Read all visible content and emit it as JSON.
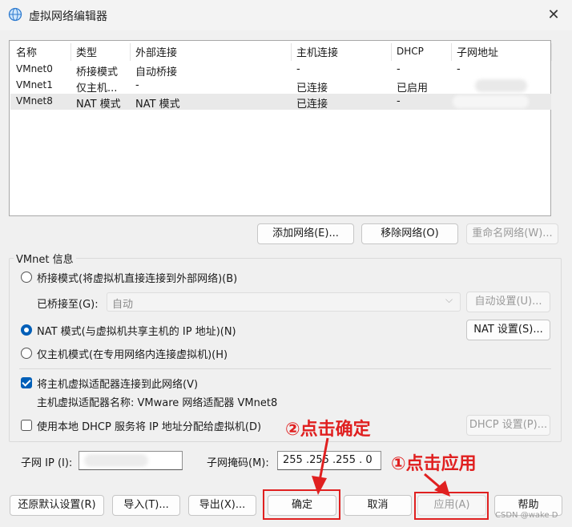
{
  "window": {
    "title": "虚拟网络编辑器",
    "close_glyph": "✕"
  },
  "table": {
    "headers": [
      "名称",
      "类型",
      "外部连接",
      "主机连接",
      "DHCP",
      "子网地址"
    ],
    "rows": [
      {
        "name": "VMnet0",
        "type": "桥接模式",
        "external": "自动桥接",
        "host": "-",
        "dhcp": "-",
        "subnet": "-"
      },
      {
        "name": "VMnet1",
        "type": "仅主机...",
        "external": "-",
        "host": "已连接",
        "dhcp": "已启用",
        "subnet": ""
      },
      {
        "name": "VMnet8",
        "type": "NAT 模式",
        "external": "NAT 模式",
        "host": "已连接",
        "dhcp": "-",
        "subnet": ""
      }
    ]
  },
  "network_buttons": {
    "add": "添加网络(E)...",
    "remove": "移除网络(O)",
    "rename": "重命名网络(W)..."
  },
  "vmnet_info": {
    "label": "VMnet 信息",
    "bridged_radio": "桥接模式(将虚拟机直接连接到外部网络)(B)",
    "bridged_to_label": "已桥接至(G):",
    "bridged_to_value": "自动",
    "auto_settings": "自动设置(U)...",
    "nat_radio": "NAT 模式(与虚拟机共享主机的 IP 地址)(N)",
    "nat_settings": "NAT 设置(S)...",
    "host_only_radio": "仅主机模式(在专用网络内连接虚拟机)(H)",
    "connect_adapter": "将主机虚拟适配器连接到此网络(V)",
    "adapter_name": "主机虚拟适配器名称: VMware 网络适配器 VMnet8",
    "dhcp_check": "使用本地 DHCP 服务将 IP 地址分配给虚拟机(D)",
    "dhcp_settings": "DHCP 设置(P)...",
    "subnet_ip_label": "子网 IP (I):",
    "subnet_mask_label": "子网掩码(M):",
    "subnet_mask_value": "255 .255 .255 . 0"
  },
  "bottom_buttons": {
    "restore": "还原默认设置(R)",
    "import": "导入(T)...",
    "export": "导出(X)...",
    "ok": "确定",
    "cancel": "取消",
    "apply": "应用(A)",
    "help": "帮助"
  },
  "annotations": {
    "ok_hint": "②点击确定",
    "apply_hint": "①点击应用",
    "color": "#e02020"
  },
  "watermark": "CSDN @wake D",
  "colors": {
    "accent": "#005fb8",
    "selected_row": "#e9e9e9"
  },
  "selected_network": "VMnet8",
  "selected_mode": "nat",
  "connect_adapter_checked": true,
  "dhcp_checked": false
}
